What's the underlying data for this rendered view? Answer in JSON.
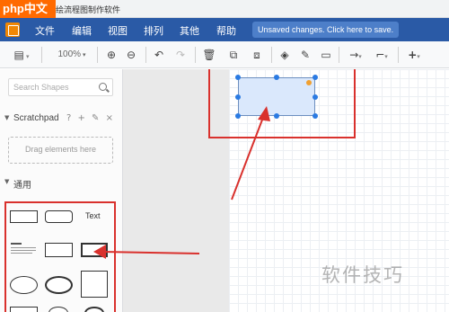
{
  "watermark": "php中文网",
  "window_title": "绘流程图制作软件",
  "menu": [
    "文件",
    "编辑",
    "视图",
    "排列",
    "其他",
    "帮助"
  ],
  "unsaved_notice": "Unsaved changes. Click here to save.",
  "toolbar": {
    "zoom": "100%",
    "icons": [
      "format-panel-icon",
      "zoom-in-icon",
      "zoom-out-icon",
      "undo-icon",
      "redo-icon",
      "delete-icon",
      "to-front-icon",
      "to-back-icon",
      "fill-color-icon",
      "line-color-icon",
      "shadow-icon",
      "connection-icon",
      "waypoint-icon",
      "insert-icon"
    ]
  },
  "sidebar": {
    "search_placeholder": "Search Shapes",
    "scratchpad": {
      "title": "Scratchpad",
      "tools": "? + ✎ ×",
      "drop_hint": "Drag elements here"
    },
    "general": {
      "title": "通用",
      "text_label": "Text"
    }
  },
  "colors": {
    "menubar": "#2a5aa6",
    "highlight": "#d9312d",
    "node_fill": "#dae8fc",
    "node_stroke": "#6c8ebf",
    "handle": "#2a7ae2"
  },
  "corner_watermark": "软件技巧"
}
